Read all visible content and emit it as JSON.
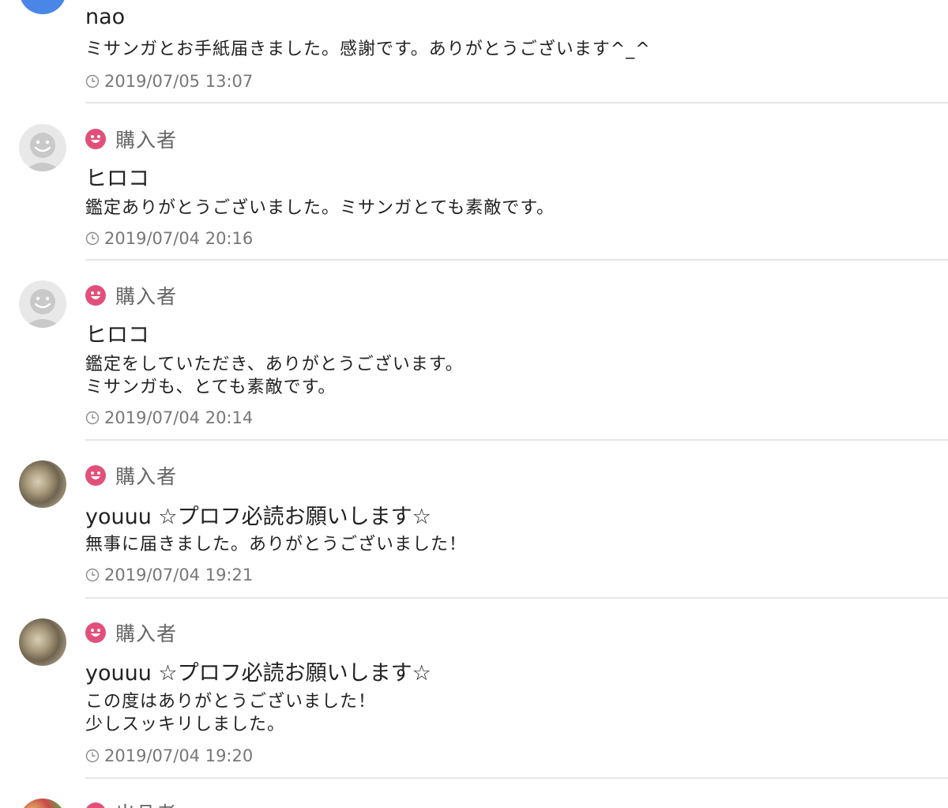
{
  "comments": [
    {
      "name": "nao",
      "message_lines": [
        "ミサンガとお手紙届きました。感謝です。ありがとうございます^_^"
      ],
      "timestamp": "2019/07/05 13:07"
    },
    {
      "role": "購入者",
      "name": "ヒロコ",
      "message_lines": [
        "鑑定ありがとうございました。ミサンガとても素敵です。"
      ],
      "timestamp": "2019/07/04 20:16"
    },
    {
      "role": "購入者",
      "name": "ヒロコ",
      "message_lines": [
        "鑑定をしていただき、ありがとうございます。",
        "ミサンガも、とても素敵です。"
      ],
      "timestamp": "2019/07/04 20:14"
    },
    {
      "role": "購入者",
      "name": "youuu ☆プロフ必読お願いします☆",
      "message_lines": [
        "無事に届きました。ありがとうございました！"
      ],
      "timestamp": "2019/07/04 19:21"
    },
    {
      "role": "購入者",
      "name": "youuu ☆プロフ必読お願いします☆",
      "message_lines": [
        "この度はありがとうございました！",
        "少しスッキリしました。"
      ],
      "timestamp": "2019/07/04 19:20"
    },
    {
      "role": "出品者"
    }
  ],
  "icons": {
    "role": "smiley-icon",
    "time": "clock-icon"
  },
  "colors": {
    "role_icon": "#e2507a",
    "divider": "#e6e6e6",
    "meta_text": "#777777"
  }
}
